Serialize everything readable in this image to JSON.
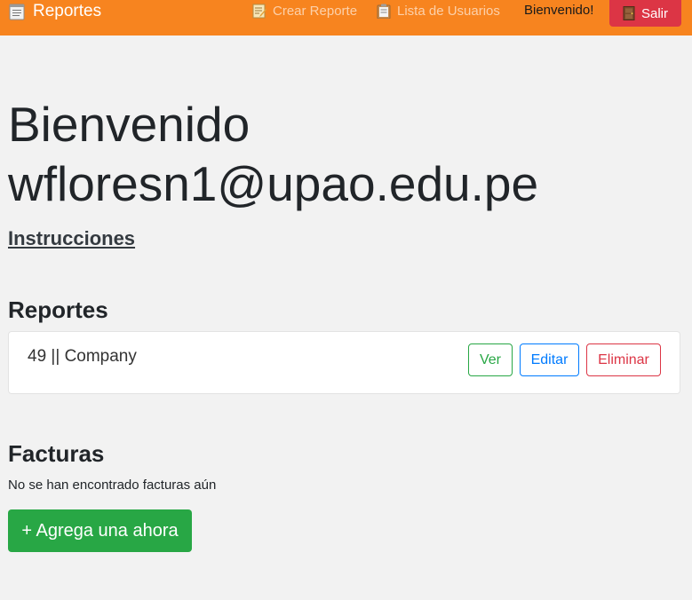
{
  "navbar": {
    "brand": {
      "label": "Reportes",
      "icon": "notepad-icon"
    },
    "links": [
      {
        "label": "Crear Reporte",
        "icon": "memo-icon"
      },
      {
        "label": "Lista de Usuarios",
        "icon": "clipboard-icon"
      }
    ],
    "welcome": "Bienvenido!",
    "logout": {
      "label": "Salir",
      "icon": "door-icon"
    }
  },
  "hero": {
    "line1": "Bienvenido",
    "line2": "wfloresn1@upao.edu.pe"
  },
  "instructions_link": "Instrucciones",
  "reportes": {
    "heading": "Reportes",
    "items": [
      {
        "title": "49 || Company",
        "actions": {
          "view": "Ver",
          "edit": "Editar",
          "delete": "Eliminar"
        }
      }
    ]
  },
  "facturas": {
    "heading": "Facturas",
    "empty_message": "No se han encontrado facturas aún",
    "add_button": "+ Agrega una ahora"
  },
  "colors": {
    "navbar": "#f7841f",
    "danger": "#dc3545",
    "success": "#28a745",
    "primary": "#007bff",
    "background": "#f2f2f2"
  }
}
